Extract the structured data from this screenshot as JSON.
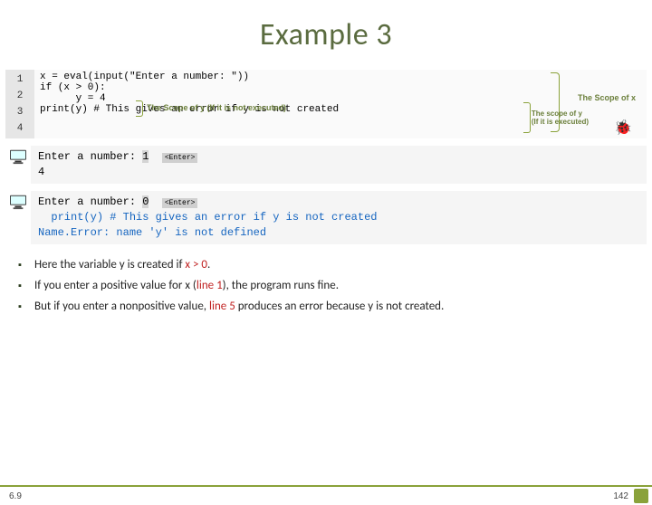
{
  "title": "Example 3",
  "code": {
    "line_nums": "1\n2\n3\n4",
    "body": "x = eval(input(\"Enter a number: \"))\nif (x > 0):\n      y = 4\nprint(y) # This gives an error if y is not created"
  },
  "ann": {
    "scope_y": "The Scope of y (If it is not executed)",
    "scope_x": "The Scope of x",
    "scope_y2": "The scope of y\n(If it is executed)"
  },
  "run1": {
    "prompt": "Enter a number: ",
    "input": "1",
    "enter": "<Enter>",
    "out": "4"
  },
  "run2": {
    "prompt": "Enter a number: ",
    "input": "0",
    "enter": "<Enter>",
    "out1": "  print(y) # This gives an error if y is not created",
    "out2": "Name.Error: name 'y' is not defined"
  },
  "bullets": {
    "b1a": "Here the variable y is created if ",
    "b1b": "x > 0",
    "b1c": ".",
    "b2a": "If you enter a positive value for x (",
    "b2b": "line 1",
    "b2c": "), the program runs fine.",
    "b3a": "But if you enter a nonpositive value, ",
    "b3b": "line 5",
    "b3c": " produces an error because y is not created."
  },
  "footer": {
    "left": "6.9",
    "right": "142"
  }
}
